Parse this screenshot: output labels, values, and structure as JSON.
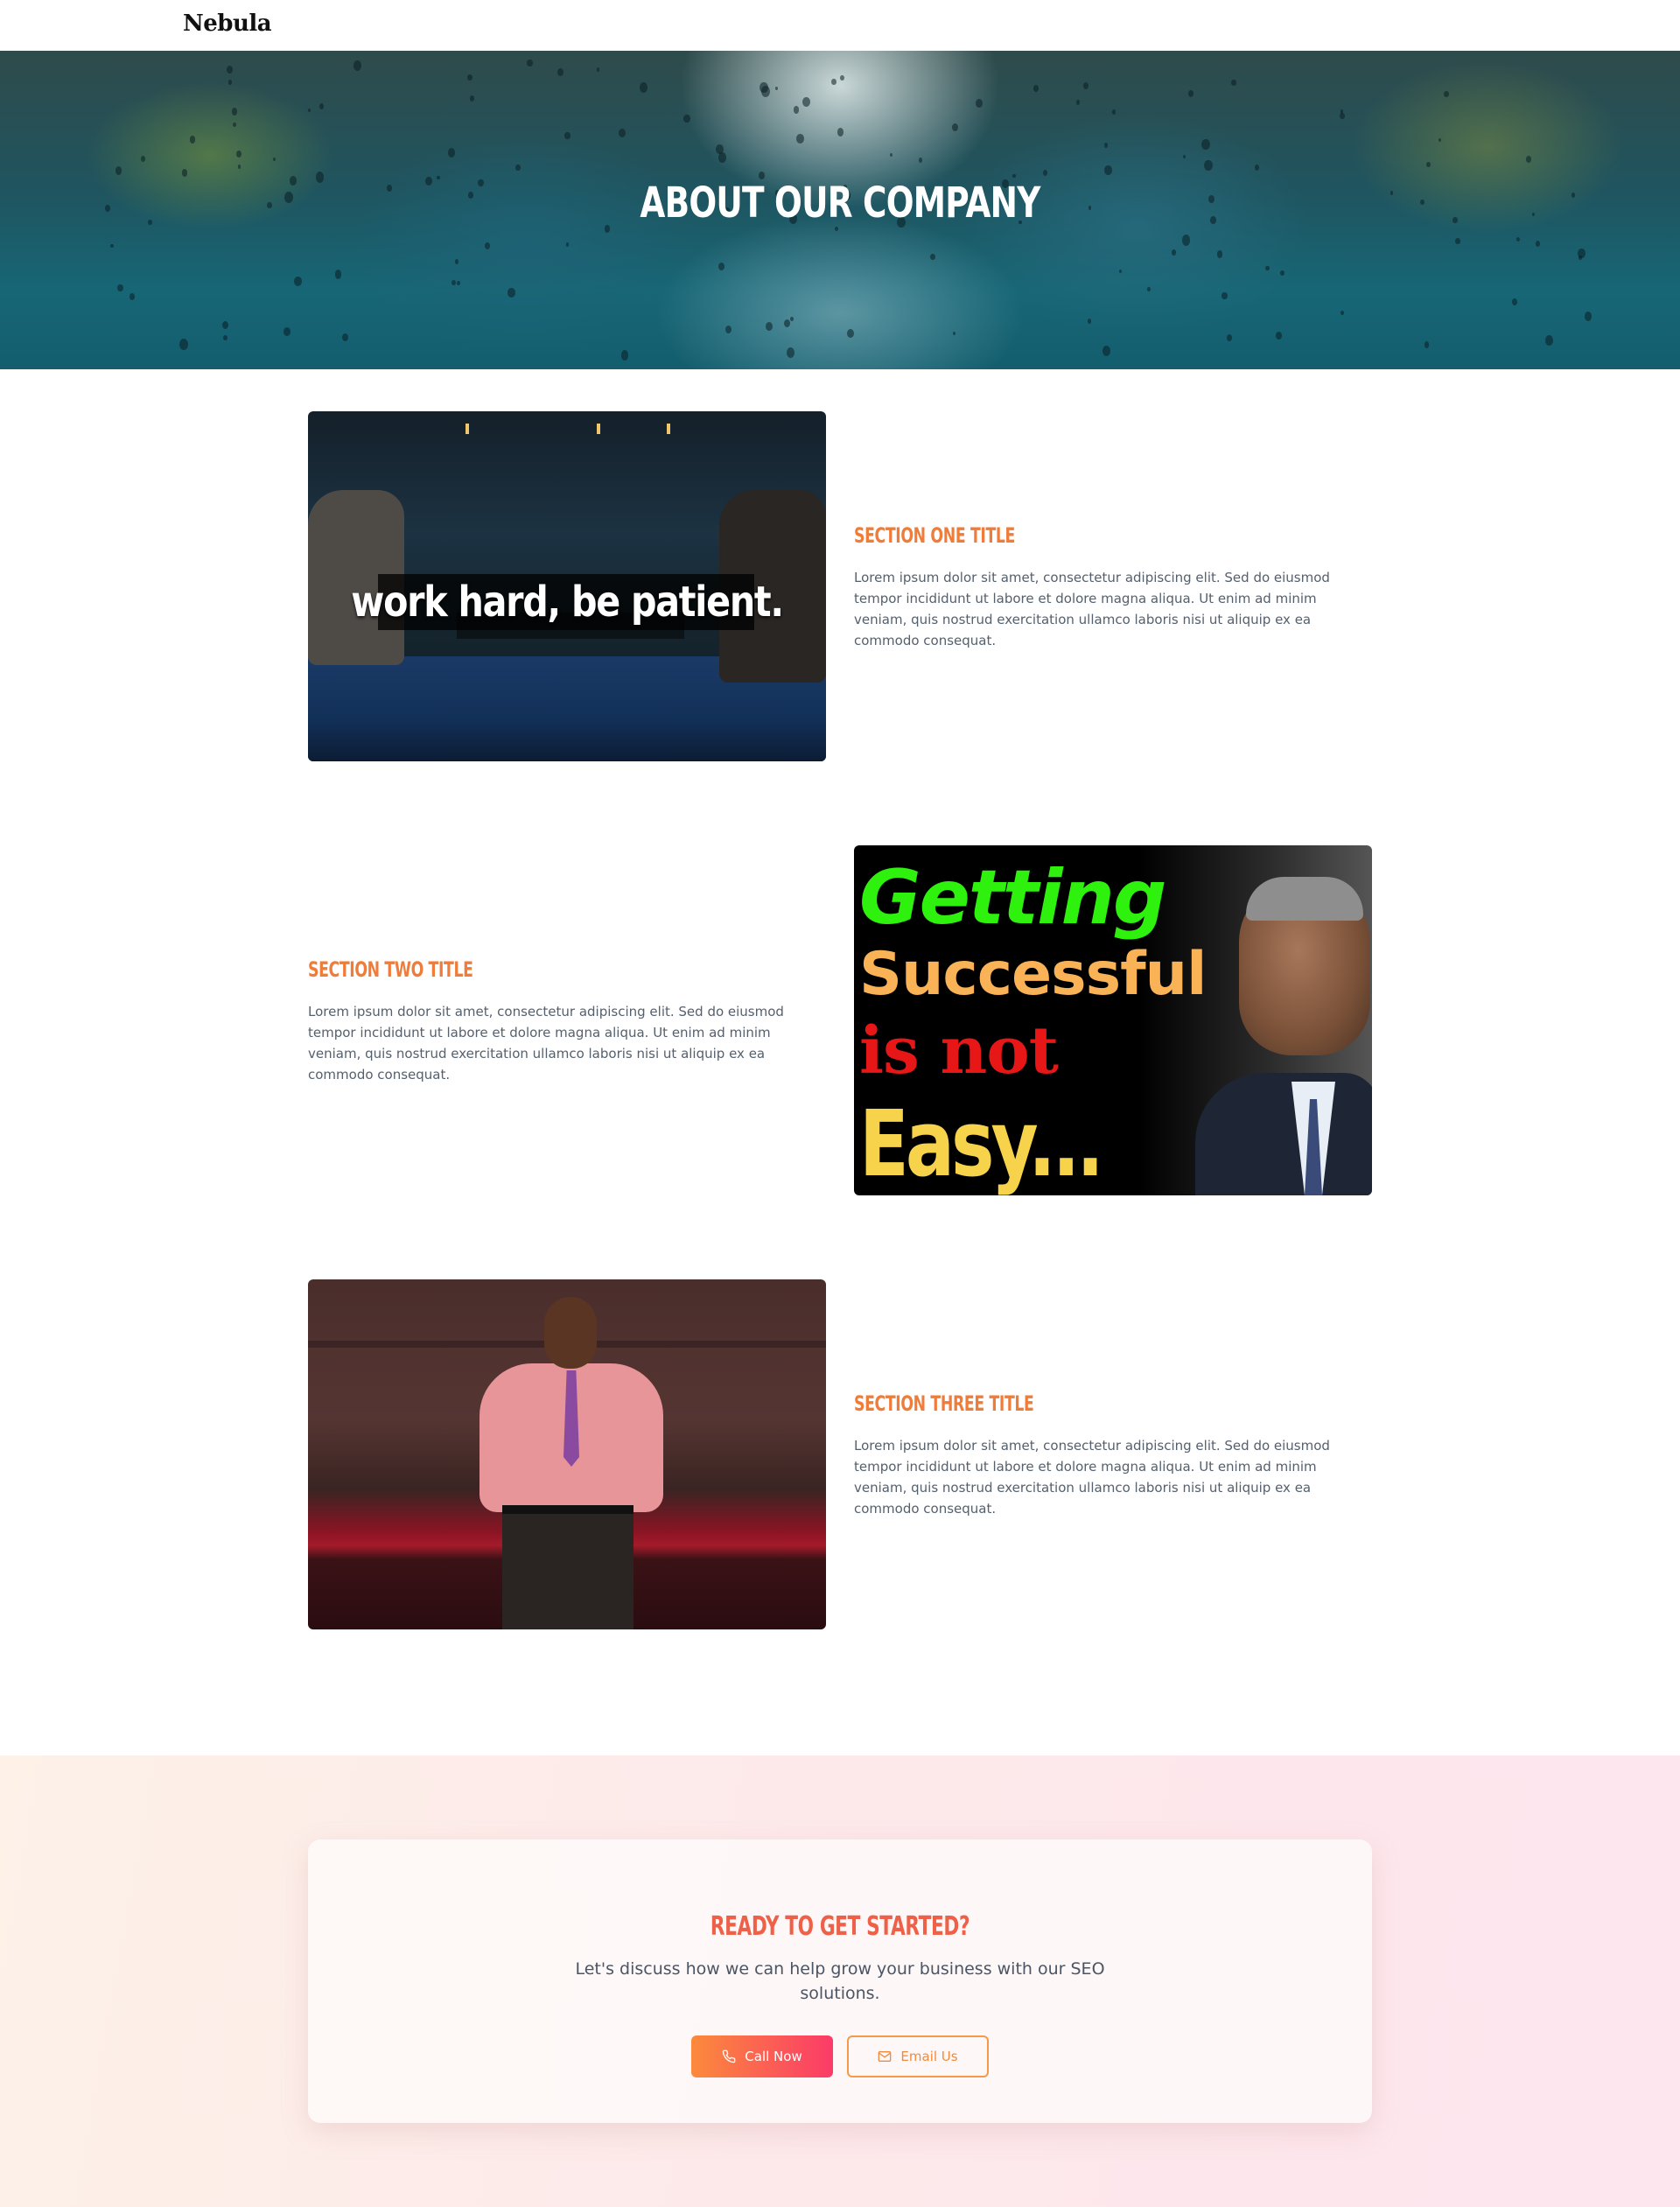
{
  "header": {
    "logo": "Nebula"
  },
  "hero": {
    "title": "ABOUT OUR COMPANY"
  },
  "sections": [
    {
      "title": "SECTION ONE TITLE",
      "body": "Lorem ipsum dolor sit amet, consectetur adipiscing elit. Sed do eiusmod tempor incididunt ut labore et dolore magna aliqua. Ut enim ad minim veniam, quis nostrud exercitation ullamco laboris nisi ut aliquip ex ea commodo consequat.",
      "image_caption": "work hard, be patient."
    },
    {
      "title": "SECTION TWO TITLE",
      "body": "Lorem ipsum dolor sit amet, consectetur adipiscing elit. Sed do eiusmod tempor incididunt ut labore et dolore magna aliqua. Ut enim ad minim veniam, quis nostrud exercitation ullamco laboris nisi ut aliquip ex ea commodo consequat.",
      "image_words": [
        "Getting",
        "Successful",
        "is not",
        "Easy..."
      ]
    },
    {
      "title": "SECTION THREE TITLE",
      "body": "Lorem ipsum dolor sit amet, consectetur adipiscing elit. Sed do eiusmod tempor incididunt ut labore et dolore magna aliqua. Ut enim ad minim veniam, quis nostrud exercitation ullamco laboris nisi ut aliquip ex ea commodo consequat."
    }
  ],
  "cta": {
    "title": "READY TO GET STARTED?",
    "text": "Let's discuss how we can help grow your business with our SEO solutions.",
    "call_label": "Call Now",
    "email_label": "Email Us",
    "call_icon": "phone-icon",
    "email_icon": "mail-icon"
  },
  "colors": {
    "accent": "#f07c3a",
    "cta_gradient_start": "#fb8a3c",
    "cta_gradient_end": "#fb3b68"
  }
}
